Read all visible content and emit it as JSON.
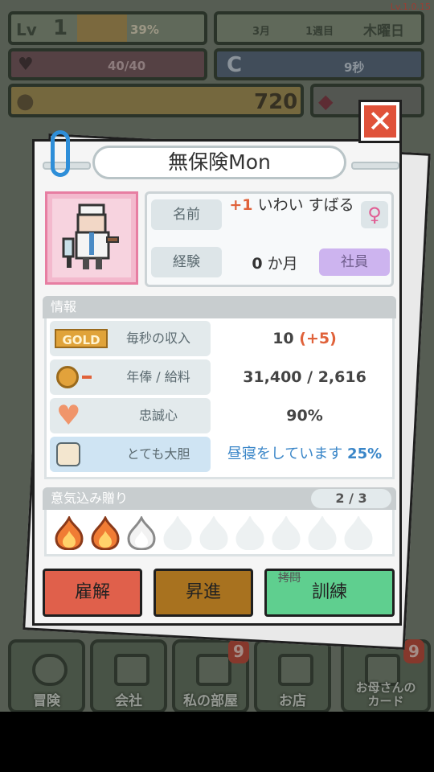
{
  "hud": {
    "level_label": "Lv",
    "level": "1",
    "exp_percent_text": "39%",
    "exp_fraction": 0.39,
    "month": "3月",
    "week": "1週目",
    "weekday": "木曜日",
    "hp": "40/40",
    "timer": "9秒",
    "gold": "720",
    "version": "Lv.1.0.15"
  },
  "nav": [
    {
      "label": "冒険"
    },
    {
      "label": "会社"
    },
    {
      "label": "私の部屋",
      "badge": "9"
    },
    {
      "label": "お店"
    },
    {
      "label": "お母さんの\nカード",
      "badge": "9"
    }
  ],
  "dialog": {
    "title": "無保険Mon",
    "close_symbol": "✕",
    "profile": {
      "name_label": "名前",
      "name_prefix": "+1",
      "name": "いわい すばる",
      "gender_symbol": "♀",
      "exp_label": "経験",
      "exp_value": "0",
      "exp_unit": "か月",
      "role": "社員"
    },
    "info": {
      "header": "情報",
      "rows": [
        {
          "icon": "GOLD",
          "label": "毎秒の収入",
          "value": "10",
          "extra": "(+5)"
        },
        {
          "label": "年俸 / 給料",
          "value": "31,400 / 2,616"
        },
        {
          "label": "忠誠心",
          "value": "90%"
        },
        {
          "label": "とても大胆",
          "value": "昼寝をしています",
          "extra": "25%"
        }
      ]
    },
    "motivation": {
      "header": "意気込み贈り",
      "count": "2 / 3",
      "filled": 2,
      "partial": 1,
      "total": 9
    },
    "buttons": {
      "fire": "雇解",
      "promote": "昇進",
      "train_strike": "拷問",
      "train": "訓練"
    }
  },
  "colors": {
    "fire": "#e0604b",
    "promote": "#a8721f",
    "train": "#5fcf8f",
    "accent_blue": "#3a86c8",
    "accent_red": "#e0623a"
  }
}
